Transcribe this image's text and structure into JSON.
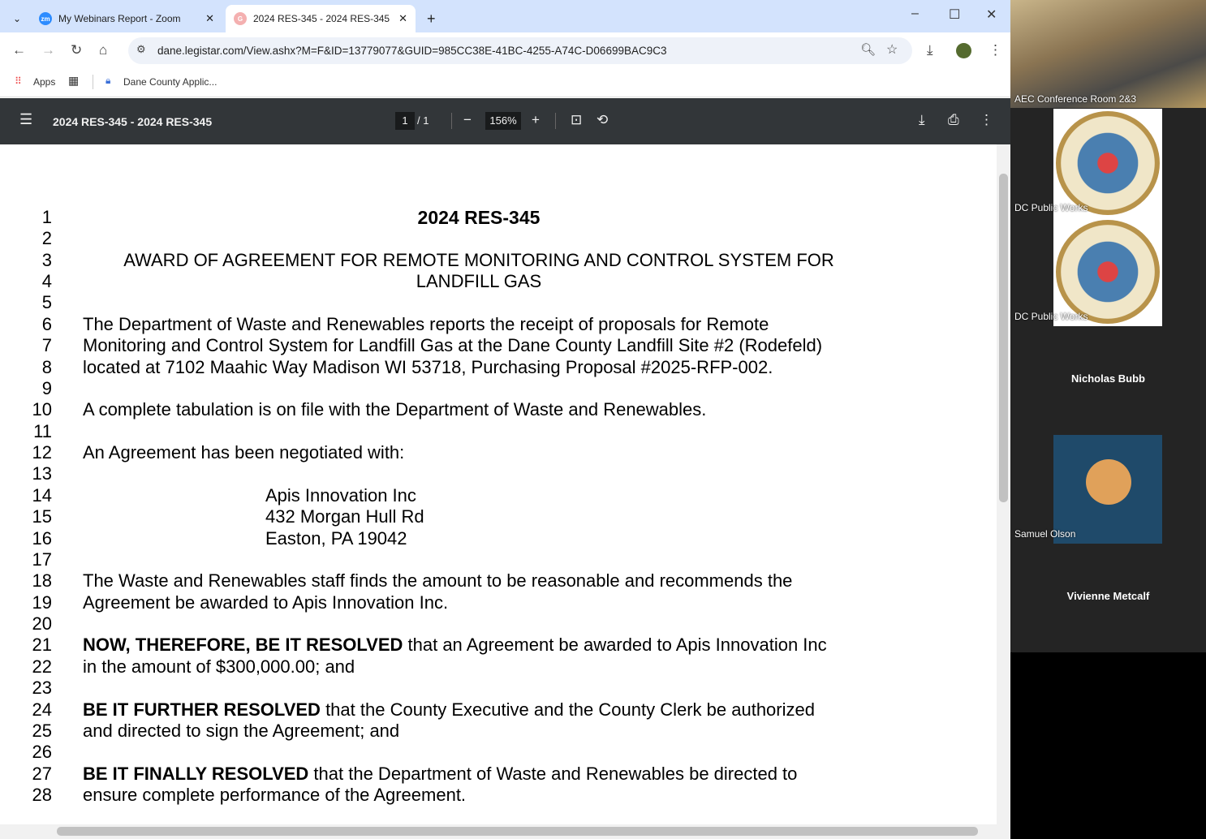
{
  "browser": {
    "tabs": [
      {
        "label": "My Webinars Report - Zoom",
        "icon": "zoom-icon"
      },
      {
        "label": "2024 RES-345 - 2024 RES-345",
        "icon": "legistar-icon",
        "active": true
      }
    ],
    "url": "dane.legistar.com/View.ashx?M=F&ID=13779077&GUID=985CC38E-41BC-4255-A74C-D06699BAC9C3",
    "bookmarks": [
      {
        "label": "Apps"
      },
      {
        "label": "Dane County Applic..."
      }
    ]
  },
  "pdf": {
    "title": "2024 RES-345 - 2024 RES-345",
    "page": "1",
    "total": "/  1",
    "zoom": "156%"
  },
  "document": {
    "lines": [
      {
        "n": "1",
        "text": "2024 RES-345",
        "style": "title"
      },
      {
        "n": "2",
        "text": ""
      },
      {
        "n": "3",
        "text": "AWARD OF AGREEMENT FOR REMOTE MONITORING AND CONTROL SYSTEM FOR",
        "style": "center"
      },
      {
        "n": "4",
        "text": "LANDFILL GAS",
        "style": "center"
      },
      {
        "n": "5",
        "text": ""
      },
      {
        "n": "6",
        "text": "The Department of Waste and Renewables reports the receipt of proposals for Remote"
      },
      {
        "n": "7",
        "text": "Monitoring and Control System for Landfill Gas at the Dane County Landfill Site #2 (Rodefeld)"
      },
      {
        "n": "8",
        "text": "located at 7102 Maahic Way Madison WI 53718, Purchasing Proposal #2025-RFP-002."
      },
      {
        "n": "9",
        "text": ""
      },
      {
        "n": "10",
        "text": "A complete tabulation is on file with the Department of Waste and Renewables."
      },
      {
        "n": "11",
        "text": ""
      },
      {
        "n": "12",
        "text": "An Agreement has been negotiated with:"
      },
      {
        "n": "13",
        "text": ""
      },
      {
        "n": "14",
        "text": "Apis Innovation Inc",
        "style": "indent"
      },
      {
        "n": "15",
        "text": "432 Morgan Hull Rd",
        "style": "indent"
      },
      {
        "n": "16",
        "text": "Easton, PA 19042",
        "style": "indent"
      },
      {
        "n": "17",
        "text": ""
      },
      {
        "n": "18",
        "text": "The Waste and Renewables staff finds the amount to be reasonable and recommends the"
      },
      {
        "n": "19",
        "text": "Agreement be awarded to Apis Innovation Inc."
      },
      {
        "n": "20",
        "text": ""
      },
      {
        "n": "21",
        "bold": "NOW, THEREFORE, BE IT RESOLVED",
        "text": " that an Agreement be awarded to Apis Innovation Inc"
      },
      {
        "n": "22",
        "text": "in the amount of $300,000.00; and"
      },
      {
        "n": "23",
        "text": ""
      },
      {
        "n": "24",
        "bold": "BE IT FURTHER RESOLVED",
        "text": " that the County Executive and the County Clerk be authorized"
      },
      {
        "n": "25",
        "text": "and directed to sign the Agreement; and"
      },
      {
        "n": "26",
        "text": ""
      },
      {
        "n": "27",
        "bold": "BE IT FINALLY RESOLVED",
        "text": " that the Department of Waste and Renewables be directed to"
      },
      {
        "n": "28",
        "text": "ensure complete performance of the Agreement."
      }
    ]
  },
  "participants": [
    {
      "name": "AEC Conference Room 2&3"
    },
    {
      "name": "DC Public Works"
    },
    {
      "name": "DC Public Works"
    },
    {
      "name": "Nicholas Bubb"
    },
    {
      "name": "Samuel Olson"
    },
    {
      "name": "Vivienne Metcalf"
    }
  ]
}
